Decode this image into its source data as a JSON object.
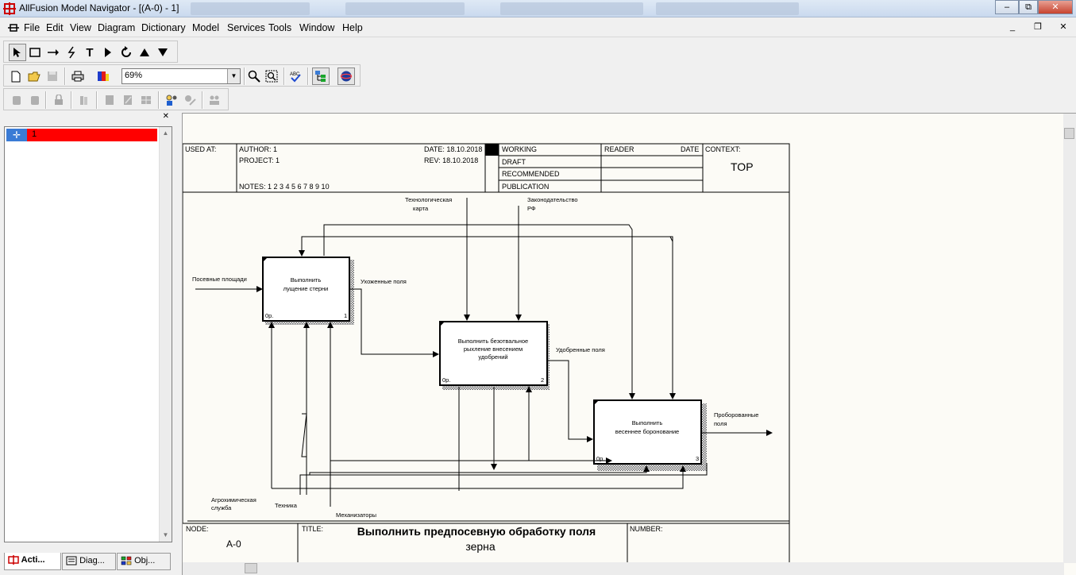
{
  "window": {
    "title": "AllFusion Model Navigator - [(A-0)  - 1]",
    "minimize": "–",
    "restore": "⧉",
    "close": "✕"
  },
  "menu": {
    "items": [
      "File",
      "Edit",
      "View",
      "Diagram",
      "Dictionary",
      "Model",
      "Services",
      "Tools",
      "Window",
      "Help"
    ],
    "mdi_minimize": "_",
    "mdi_restore": "❐",
    "mdi_close": "✕"
  },
  "toolbar": {
    "zoom_value": "69%",
    "zoom_arrow": "▼"
  },
  "explorer": {
    "close_glyph": "✕",
    "tree_root_label": "1",
    "tabs": [
      "Acti...",
      "Diag...",
      "Obj..."
    ]
  },
  "diagram": {
    "header": {
      "used_at": "USED AT:",
      "author": "AUTHOR:  1",
      "project": "PROJECT:  1",
      "date": "DATE:  18.10.2018",
      "rev": "REV:   18.10.2018",
      "notes": "NOTES:  1  2  3  4  5  6  7  8  9  10",
      "status": [
        "WORKING",
        "DRAFT",
        "RECOMMENDED",
        "PUBLICATION"
      ],
      "reader": "READER",
      "date_col": "DATE",
      "context": "CONTEXT:",
      "context_value": "TOP"
    },
    "footer": {
      "node": "NODE:",
      "node_value": "A-0",
      "title_label": "TITLE:",
      "title_value": "Выполнить  предпосевную  обработку поля",
      "title_value_2": "зерна",
      "number": "NUMBER:"
    },
    "boxes": [
      {
        "line1": "Выполнить",
        "line2": "лущение стерни",
        "line3": "",
        "number": "1",
        "cost": "0р."
      },
      {
        "line1": "Выполнить безотвальное",
        "line2": "рыхление внесением",
        "line3": "удобрений",
        "number": "2",
        "cost": "0р."
      },
      {
        "line1": "Выполнить",
        "line2": "весеннее боронование",
        "line3": "",
        "number": "3",
        "cost": "0р."
      }
    ],
    "arrows": {
      "input_area": "Посевные площади",
      "output_1": "Ухоженные поля",
      "output_2": "Удобренные поля",
      "output_3a": "Проборованные",
      "output_3b": "поля",
      "control_1a": "Технологическая",
      "control_1b": "карта",
      "control_2a": "Законодательство",
      "control_2b": "РФ",
      "mech_1a": "Агрохимическая",
      "mech_1b": "служба",
      "mech_2": "Техника",
      "mech_3": "Механизаторы"
    }
  },
  "colors": {
    "tree_selected": "#ff0000",
    "canvas_bg": "#fcfbf6",
    "title_bar": "#c9d9ee"
  }
}
